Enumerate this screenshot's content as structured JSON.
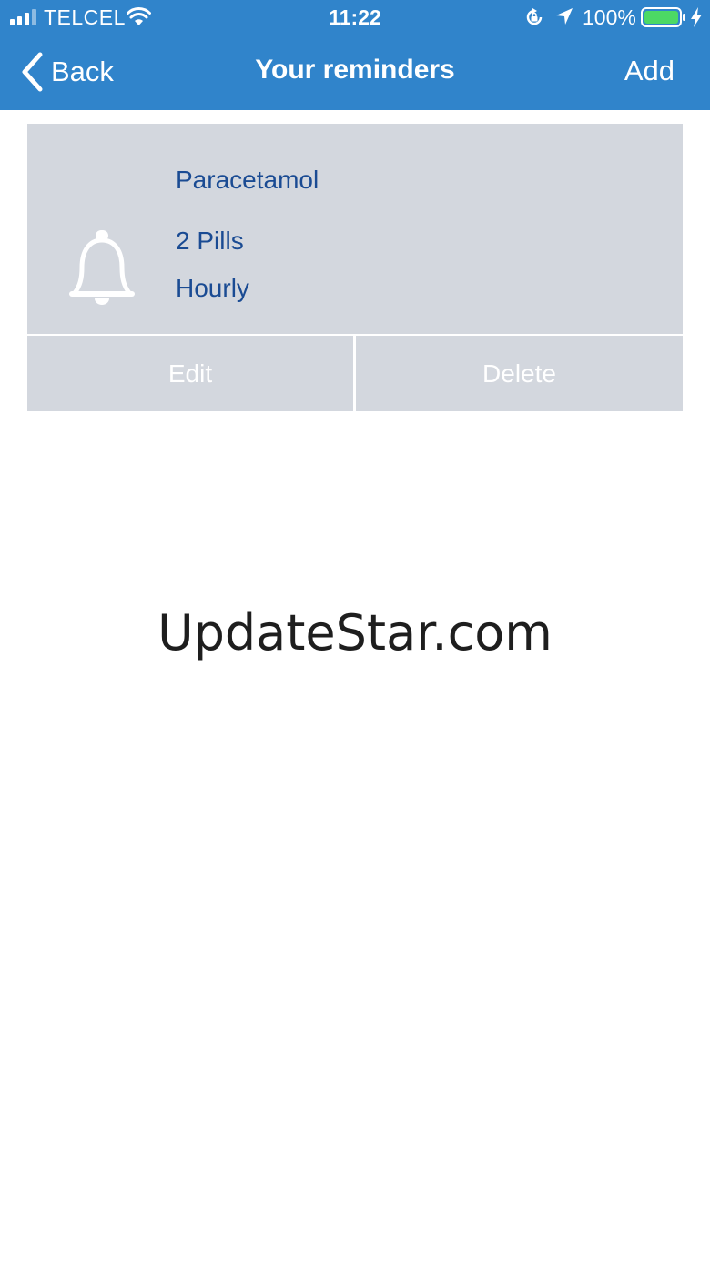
{
  "status_bar": {
    "carrier": "TELCEL",
    "time": "11:22",
    "battery": "100%",
    "icons": [
      "signal-icon",
      "wifi-icon",
      "orientation-lock-icon",
      "location-icon",
      "battery-icon",
      "charging-icon"
    ]
  },
  "nav": {
    "back_label": "Back",
    "title": "Your reminders",
    "add_label": "Add"
  },
  "reminders": [
    {
      "icon": "bell-icon",
      "name": "Paracetamol",
      "dose": "2 Pills",
      "frequency": "Hourly",
      "edit_label": "Edit",
      "delete_label": "Delete"
    }
  ],
  "watermark": "UpdateStar.com",
  "colors": {
    "accent": "#3084cb",
    "card": "#d3d7de",
    "text_blue": "#1a4b93",
    "battery_green": "#4cd964"
  }
}
